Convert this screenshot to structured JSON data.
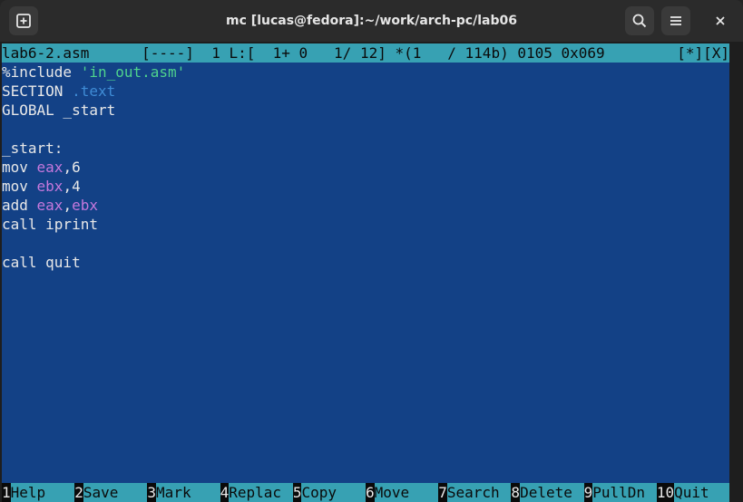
{
  "window": {
    "title": "mc [lucas@fedora]:~/work/arch-pc/lab06"
  },
  "editor": {
    "status_left": "lab6-2.asm      [----]  1 L:[  1+ 0   1/ 12] *(1   / 114b) 0105 0x069",
    "status_right": "[*][X]",
    "lines": [
      {
        "parts": [
          {
            "t": "%include ",
            "c": "txt"
          },
          {
            "t": "'in_out.asm'",
            "c": "str"
          }
        ]
      },
      {
        "parts": [
          {
            "t": "SECTION ",
            "c": "txt"
          },
          {
            "t": ".text",
            "c": "dot"
          }
        ]
      },
      {
        "parts": [
          {
            "t": "GLOBAL _start",
            "c": "txt"
          }
        ]
      },
      {
        "parts": []
      },
      {
        "parts": [
          {
            "t": "_start:",
            "c": "txt"
          }
        ]
      },
      {
        "parts": [
          {
            "t": "mov ",
            "c": "txt"
          },
          {
            "t": "eax",
            "c": "reg"
          },
          {
            "t": ",6",
            "c": "txt"
          }
        ]
      },
      {
        "parts": [
          {
            "t": "mov ",
            "c": "txt"
          },
          {
            "t": "ebx",
            "c": "reg"
          },
          {
            "t": ",4",
            "c": "txt"
          }
        ]
      },
      {
        "parts": [
          {
            "t": "add ",
            "c": "txt"
          },
          {
            "t": "eax",
            "c": "reg"
          },
          {
            "t": ",",
            "c": "txt"
          },
          {
            "t": "ebx",
            "c": "reg"
          }
        ]
      },
      {
        "parts": [
          {
            "t": "call iprint",
            "c": "txt"
          }
        ]
      },
      {
        "parts": []
      },
      {
        "parts": [
          {
            "t": "call quit",
            "c": "txt"
          }
        ]
      }
    ]
  },
  "fkeys": [
    {
      "num": "1",
      "label": "Help"
    },
    {
      "num": "2",
      "label": "Save"
    },
    {
      "num": "3",
      "label": "Mark"
    },
    {
      "num": "4",
      "label": "Replac"
    },
    {
      "num": "5",
      "label": "Copy"
    },
    {
      "num": "6",
      "label": "Move"
    },
    {
      "num": "7",
      "label": "Search"
    },
    {
      "num": "8",
      "label": "Delete"
    },
    {
      "num": "9",
      "label": "PullDn"
    },
    {
      "num": "10",
      "label": "Quit"
    }
  ],
  "icons": {
    "new_tab": "new-tab-icon",
    "search": "search-icon",
    "menu": "hamburger-menu-icon",
    "close": "close-icon"
  },
  "colors": {
    "editor_bg": "#134186",
    "bar_bg": "#37a1b3",
    "string": "#4fd38d",
    "directive": "#3f8cd6",
    "register": "#c678dd"
  }
}
